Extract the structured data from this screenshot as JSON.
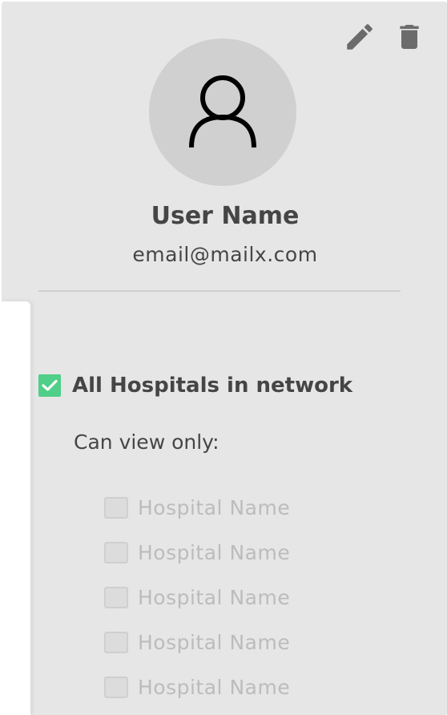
{
  "user": {
    "name": "User Name",
    "email": "email@mailx.com"
  },
  "toolbar": {
    "edit_icon": "pencil-icon",
    "delete_icon": "trash-icon"
  },
  "access": {
    "all_hospitals_label": "All Hospitals in network",
    "all_hospitals_checked": true,
    "can_view_label": "Can view only:",
    "hospitals": [
      {
        "label": "Hospital Name",
        "checked": false,
        "disabled": true
      },
      {
        "label": "Hospital Name",
        "checked": false,
        "disabled": true
      },
      {
        "label": "Hospital Name",
        "checked": false,
        "disabled": true
      },
      {
        "label": "Hospital Name",
        "checked": false,
        "disabled": true
      },
      {
        "label": "Hospital Name",
        "checked": false,
        "disabled": true
      }
    ]
  },
  "colors": {
    "card_background": "#e6e6e6",
    "checked_accent": "#4fcf87",
    "text_primary": "#454545",
    "text_disabled": "#bcbcbc",
    "icon_color": "#6b6b6b"
  }
}
